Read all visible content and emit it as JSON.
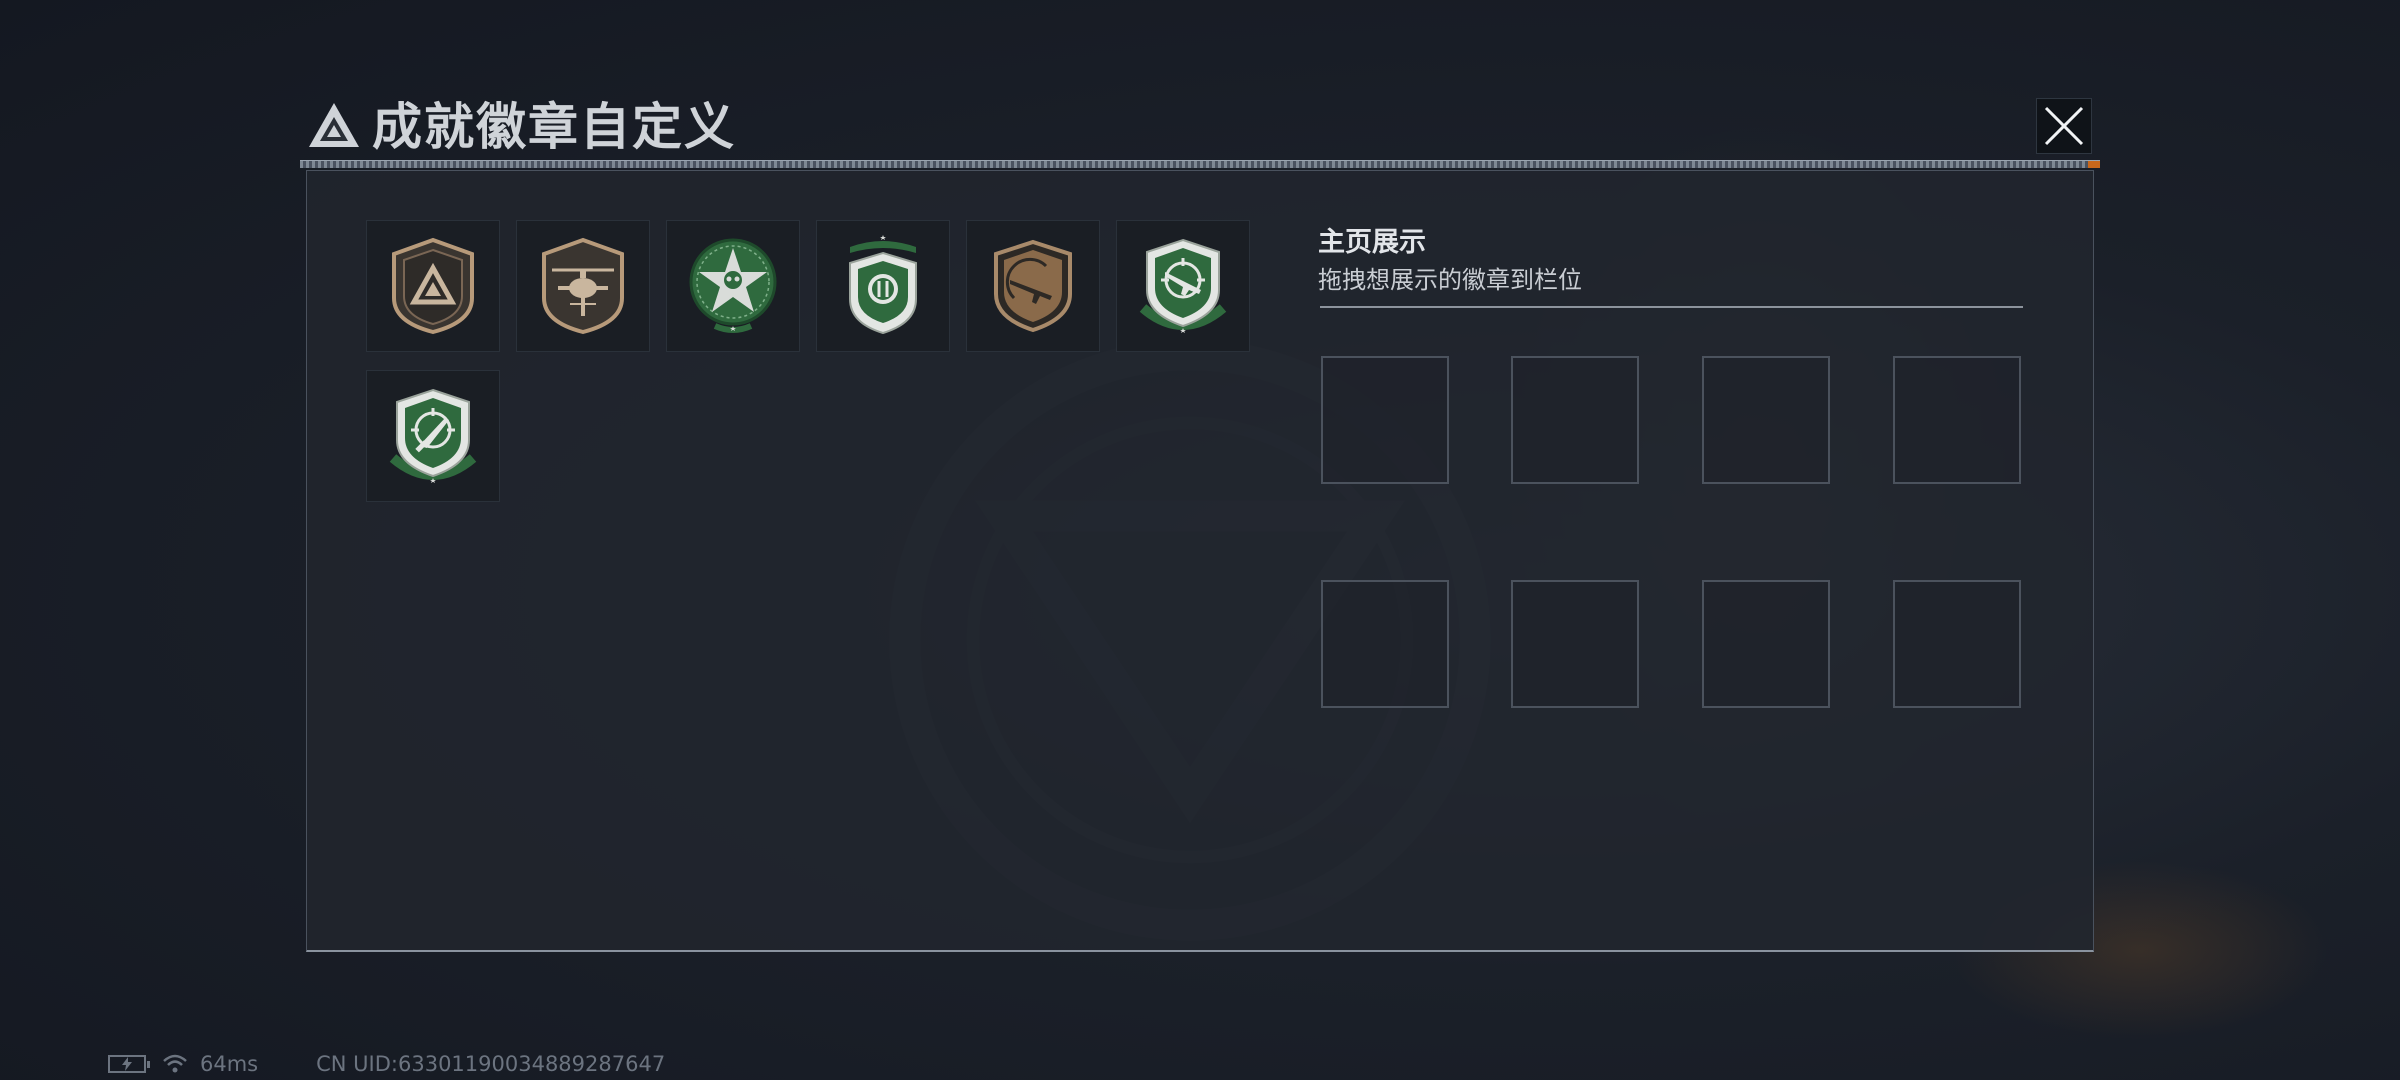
{
  "dialog": {
    "title": "成就徽章自定义",
    "close_icon": "close-icon"
  },
  "badges": [
    {
      "icon": "triangle-shield-badge-icon",
      "color": "#b79a7a"
    },
    {
      "icon": "helicopter-shield-badge-icon",
      "color": "#b79a7a"
    },
    {
      "icon": "star-skull-green-badge-icon",
      "color": "#2f6a3e"
    },
    {
      "icon": "wing-emblem-green-badge-icon",
      "color": "#2f6a3e"
    },
    {
      "icon": "rifle-shield-gold-badge-icon",
      "color": "#8a6a4a"
    },
    {
      "icon": "crosshair-rifle-green-badge-icon",
      "color": "#2f6a3e"
    },
    {
      "icon": "crosshair-knife-green-badge-icon",
      "color": "#2f6a3e"
    }
  ],
  "display_section": {
    "title": "主页展示",
    "subtitle": "拖拽想展示的徽章到栏位",
    "slot_count": 8
  },
  "status": {
    "ping": "64ms",
    "uid": "CN UID:633011900348892876​47"
  },
  "colors": {
    "accent_orange": "#c8671c",
    "panel_bg": "#21262e",
    "badge_green": "#2f6a3e"
  }
}
